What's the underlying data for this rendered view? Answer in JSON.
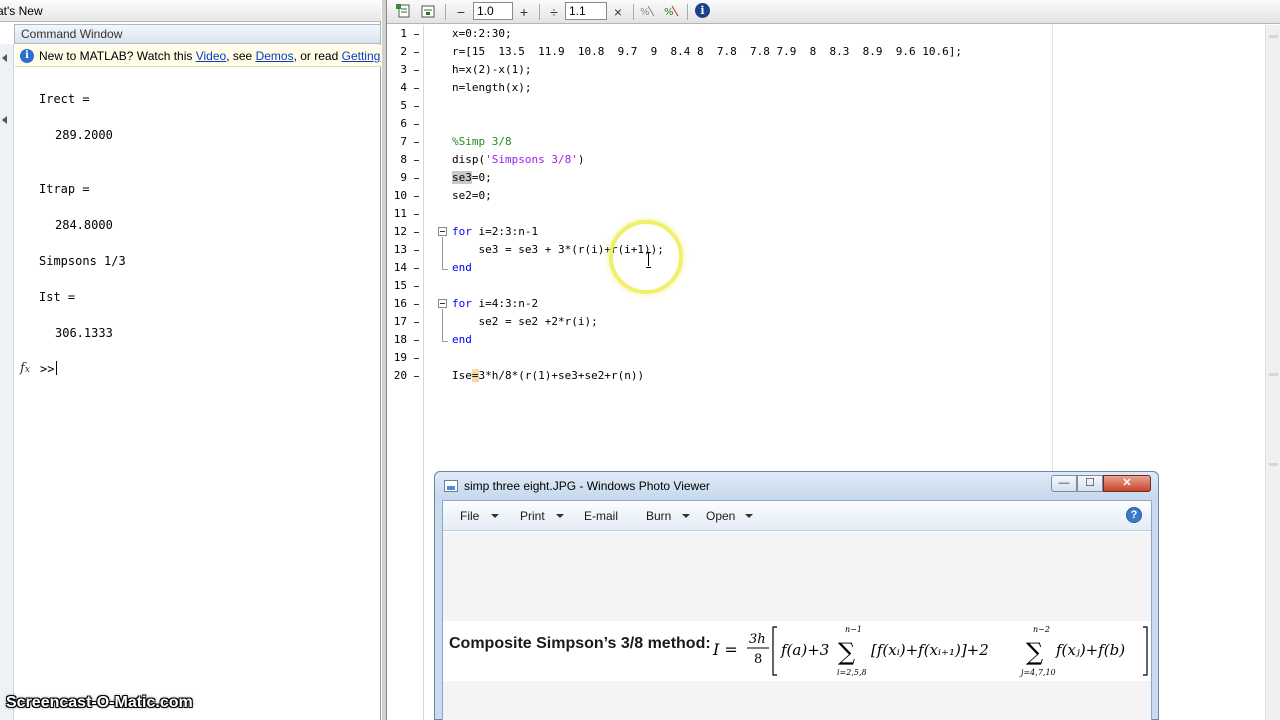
{
  "left_panel": {
    "whats_new_tab": "at's New",
    "command_window_title": "Command Window",
    "notice": {
      "prefix": "New to MATLAB? Watch this ",
      "video_link": "Video",
      "mid": ", see ",
      "demos_link": "Demos",
      "suffix": ", or read ",
      "getting_started_link": "Getting S"
    },
    "output": [
      {
        "name": "Irect =",
        "value": "289.2000"
      },
      {
        "name": "Itrap =",
        "value": "284.8000"
      },
      {
        "name": "Simpsons 1/3",
        "value": ""
      },
      {
        "name": "Ist =",
        "value": "306.1333"
      }
    ],
    "prompt": ">>",
    "fx_icon": "fx-icon"
  },
  "toolbar": {
    "minus": "−",
    "zoom_value_1": "1.0",
    "plus": "+",
    "divide": "÷",
    "zoom_value_2": "1.1",
    "times": "×"
  },
  "editor": {
    "line_numbers": [
      "1",
      "2",
      "3",
      "4",
      "5",
      "6",
      "7",
      "8",
      "9",
      "10",
      "11",
      "12",
      "13",
      "14",
      "15",
      "16",
      "17",
      "18",
      "19",
      "20"
    ],
    "lines": {
      "l1": "x=0:2:30;",
      "l2": "r=[15  13.5  11.9  10.8  9.7  9  8.4 8  7.8  7.8 7.9  8  8.3  8.9  9.6 10.6];",
      "l3": "h=x(2)-x(1);",
      "l4": "n=length(x);",
      "l7": "%Simp 3/8",
      "l8_fn": "disp(",
      "l8_str": "'Simpsons 3/8'",
      "l8_end": ")",
      "l9_hl": "se3",
      "l9_rest": "=0;",
      "l10": "se2=0;",
      "l12_kw": "for",
      "l12_rest": " i=2:3:n-1",
      "l13": "    se3 = se3 + 3*(r(i)+r(i+1));",
      "l14_kw": "end",
      "l16_kw": "for",
      "l16_rest": " i=4:3:n-2",
      "l17": "    se2 = se2 +2*r(i);",
      "l18_kw": "end",
      "l20_a": "Ise",
      "l20_hl": "=",
      "l20_b": "3*h/8*(r(1)+se3+se2+r(n))"
    }
  },
  "photo_viewer": {
    "title": "simp three eight.JPG - Windows Photo Viewer",
    "menus": [
      "File",
      "Print",
      "E-mail",
      "Burn",
      "Open"
    ],
    "min_glyph": "—",
    "max_glyph": "☐",
    "close_glyph": "✕",
    "help_glyph": "?",
    "formula_label": "Composite Simpson’s 3/8 method:",
    "formula": {
      "lhs": "I =",
      "frac_num": "3h",
      "frac_den": "8",
      "f_a": "f(a)+3",
      "sum1_top": "n−1",
      "sum1_bot": "i=2,5,8",
      "term1": "[f(xᵢ)+f(xᵢ₊₁)]+2",
      "sum2_top": "n−2",
      "sum2_bot": "j=4,7,10",
      "term2": "f(xⱼ)+f(b)"
    }
  },
  "watermark": "Screencast-O-Matic.com",
  "colors": {
    "keyword": "#0000ff",
    "comment": "#228b22",
    "string": "#a020f0",
    "halo": "#ebeb3c"
  }
}
